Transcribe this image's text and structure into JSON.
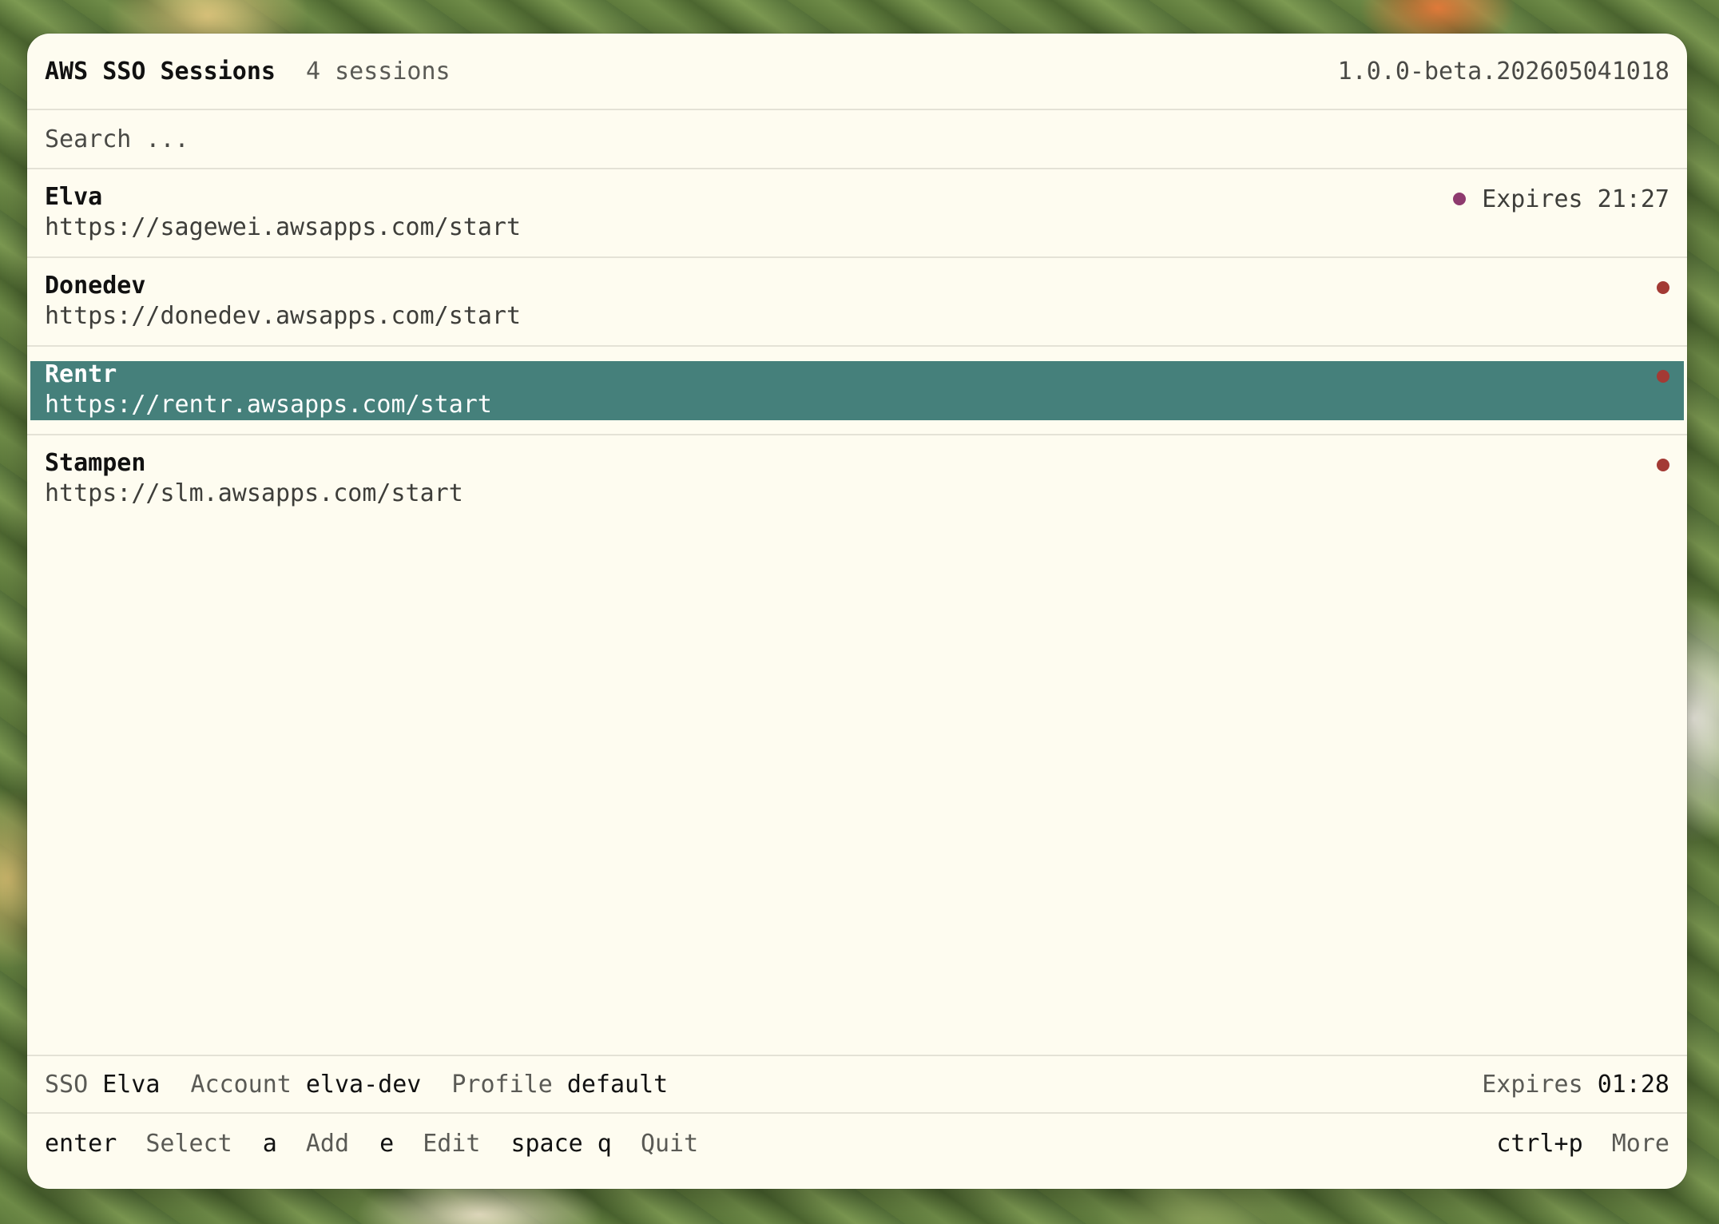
{
  "header": {
    "title": "AWS SSO Sessions",
    "session_count": "4 sessions",
    "version": "1.0.0-beta.202605041018"
  },
  "search": {
    "placeholder": "Search ...",
    "value": ""
  },
  "sessions": [
    {
      "name": "Elva",
      "url": "https://sagewei.awsapps.com/start",
      "expires": "Expires 21:27",
      "status_color": "#8e3a6e",
      "selected": false
    },
    {
      "name": "Donedev",
      "url": "https://donedev.awsapps.com/start",
      "expires": "",
      "status_color": "#a33a34",
      "selected": false
    },
    {
      "name": "Rentr",
      "url": "https://rentr.awsapps.com/start",
      "expires": "",
      "status_color": "#a33a34",
      "selected": true
    },
    {
      "name": "Stampen",
      "url": "https://slm.awsapps.com/start",
      "expires": "",
      "status_color": "#a33a34",
      "selected": false
    }
  ],
  "status_bar": {
    "sso_label": "SSO",
    "sso_value": "Elva",
    "account_label": "Account",
    "account_value": "elva-dev",
    "profile_label": "Profile",
    "profile_value": "default",
    "expires_label": "Expires",
    "expires_value": "01:28"
  },
  "shortcuts": [
    {
      "key": "enter",
      "action": "Select"
    },
    {
      "key": "a",
      "action": "Add"
    },
    {
      "key": "e",
      "action": "Edit"
    },
    {
      "key": "space q",
      "action": "Quit"
    }
  ],
  "more_shortcut": {
    "key": "ctrl+p",
    "action": "More"
  },
  "colors": {
    "selected_row": "#45807b",
    "active_dot": "#8e3a6e",
    "inactive_dot": "#a33a34",
    "window_bg": "#fefcf0"
  }
}
